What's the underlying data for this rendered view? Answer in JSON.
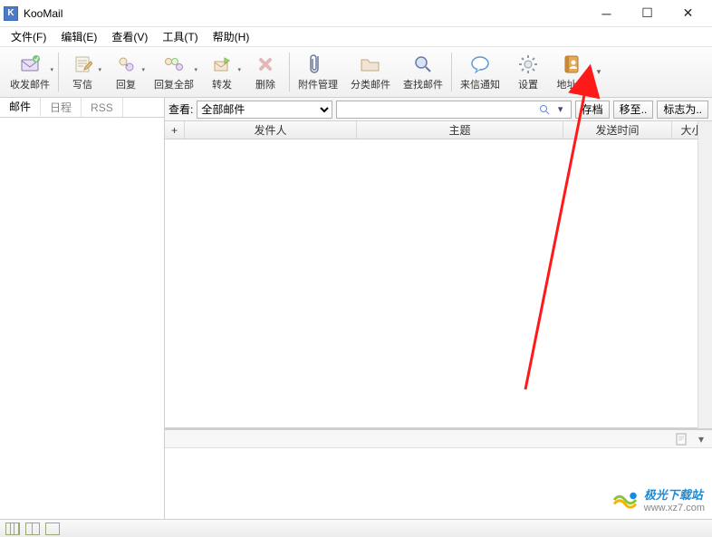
{
  "window": {
    "title": "KooMail"
  },
  "menu": {
    "file": "文件(F)",
    "edit": "编辑(E)",
    "view": "查看(V)",
    "tool": "工具(T)",
    "help": "帮助(H)"
  },
  "toolbar": {
    "receive": "收发邮件",
    "compose": "写信",
    "reply": "回复",
    "replyall": "回复全部",
    "forward": "转发",
    "delete": "删除",
    "attach": "附件管理",
    "classify": "分类邮件",
    "find": "查找邮件",
    "notify": "来信通知",
    "settings": "设置",
    "addressbook": "地址簿"
  },
  "sidebar": {
    "tab_mail": "邮件",
    "tab_calendar": "日程",
    "tab_rss": "RSS"
  },
  "filter": {
    "label": "查看:",
    "select": "全部邮件",
    "search_placeholder": "",
    "archive": "存档",
    "moveto": "移至..",
    "markas": "标志为.."
  },
  "columns": {
    "plus": "+",
    "from": "发件人",
    "subject": "主题",
    "date": "发送时间",
    "size": "大小"
  },
  "watermark": {
    "brand": "极光下载站",
    "url": "www.xz7.com"
  }
}
